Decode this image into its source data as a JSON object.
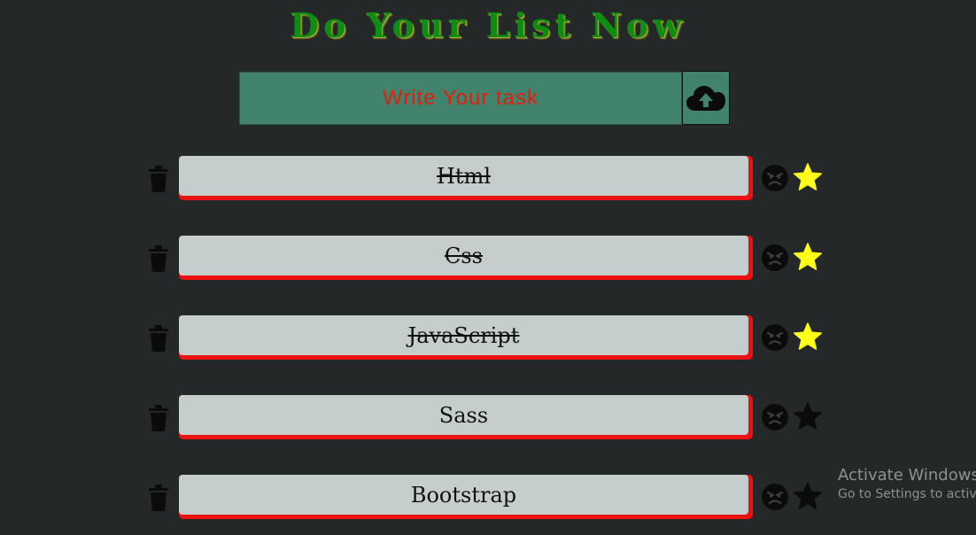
{
  "header": {
    "title": "Do Your List Now"
  },
  "task_input": {
    "placeholder": "Write Your task",
    "value": ""
  },
  "upload_button": {
    "icon": "cloud-upload-icon"
  },
  "tasks": [
    {
      "label": "Html",
      "completed": true,
      "starred": true
    },
    {
      "label": "Css",
      "completed": true,
      "starred": true
    },
    {
      "label": "JavaScript",
      "completed": true,
      "starred": true
    },
    {
      "label": "Sass",
      "completed": false,
      "starred": false
    },
    {
      "label": "Bootstrap",
      "completed": false,
      "starred": false
    }
  ],
  "icons": {
    "delete": "trash-icon",
    "mood": "angry-face-icon",
    "favorite": "star-icon"
  },
  "colors": {
    "background": "#242829",
    "title": "#0f8c12",
    "input_bg": "#41836c",
    "placeholder": "#e11f10",
    "item_bg": "#c5cecd",
    "item_shadow": "#ee1111",
    "star_active": "#ffff1a",
    "star_inactive": "#0b0b0b"
  },
  "watermark": {
    "line1": "Activate Windows",
    "line2": "Go to Settings to activate Windows."
  }
}
